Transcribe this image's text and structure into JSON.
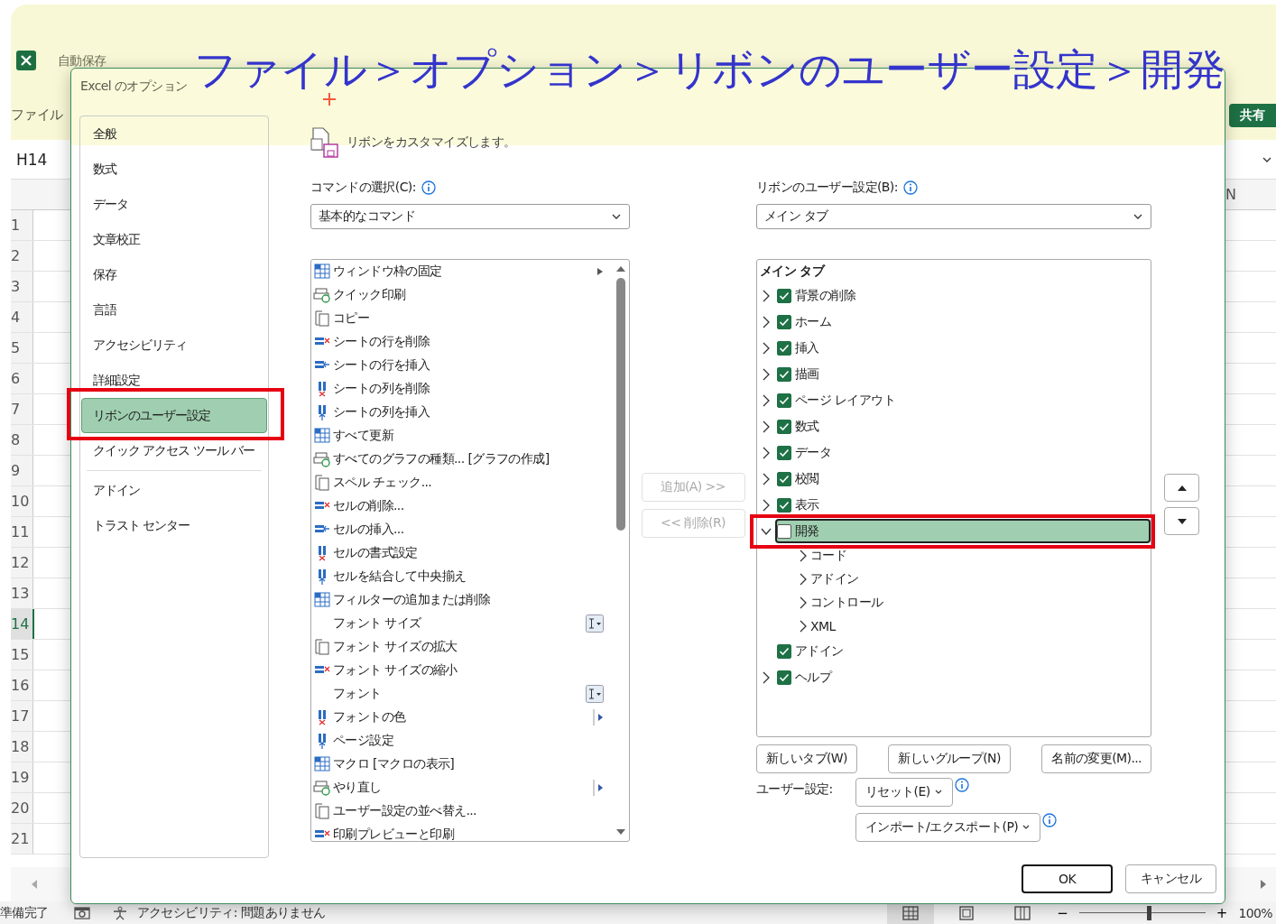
{
  "excel": {
    "autosave": "自動保存",
    "ribbon_tab": "ファイル",
    "share_button": "共有",
    "name_box": "H14",
    "column_header": "N",
    "row_numbers": [
      {
        "label": "1",
        "selected": false
      },
      {
        "label": "2",
        "selected": false
      },
      {
        "label": "3",
        "selected": false
      },
      {
        "label": "4",
        "selected": false
      },
      {
        "label": "5",
        "selected": false
      },
      {
        "label": "6",
        "selected": false
      },
      {
        "label": "7",
        "selected": false
      },
      {
        "label": "8",
        "selected": false
      },
      {
        "label": "9",
        "selected": false
      },
      {
        "label": "10",
        "selected": false
      },
      {
        "label": "11",
        "selected": false
      },
      {
        "label": "12",
        "selected": false
      },
      {
        "label": "13",
        "selected": false
      },
      {
        "label": "14",
        "selected": true
      },
      {
        "label": "15",
        "selected": false
      },
      {
        "label": "16",
        "selected": false
      },
      {
        "label": "17",
        "selected": false
      },
      {
        "label": "18",
        "selected": false
      },
      {
        "label": "19",
        "selected": false
      },
      {
        "label": "20",
        "selected": false
      },
      {
        "label": "21",
        "selected": false
      }
    ],
    "status_text": "準備完了",
    "accessibility": "アクセシビリティ: 問題ありません",
    "views": [
      {
        "kind": "normal",
        "selected": true
      },
      {
        "kind": "page-layout",
        "selected": false
      },
      {
        "kind": "page-break",
        "selected": false
      }
    ],
    "zoom": {
      "minus": "−",
      "plus": "+",
      "level": 0.55,
      "reading": "100%"
    }
  },
  "dialog": {
    "title": "Excel のオプション",
    "sidebar": {
      "groups": [
        {
          "items": [
            {
              "label": "全般",
              "selected": false,
              "highlighted": false
            },
            {
              "label": "数式",
              "selected": false,
              "highlighted": false
            },
            {
              "label": "データ",
              "selected": false,
              "highlighted": false
            },
            {
              "label": "文章校正",
              "selected": false,
              "highlighted": false
            },
            {
              "label": "保存",
              "selected": false,
              "highlighted": false
            },
            {
              "label": "言語",
              "selected": false,
              "highlighted": false
            },
            {
              "label": "アクセシビリティ",
              "selected": false,
              "highlighted": false
            },
            {
              "label": "詳細設定",
              "selected": false,
              "highlighted": false
            },
            {
              "label": "リボンのユーザー設定",
              "selected": true,
              "highlighted": true
            },
            {
              "label": "クイック アクセス ツール バー",
              "selected": false,
              "highlighted": false
            }
          ]
        },
        {
          "items": [
            {
              "label": "アドイン",
              "selected": false,
              "highlighted": false
            },
            {
              "label": "トラスト センター",
              "selected": false,
              "highlighted": false
            }
          ]
        }
      ]
    },
    "header": "リボンをカスタマイズします。",
    "commands": {
      "label": "コマンドの選択(C):",
      "dropdown": "基本的なコマンド",
      "items": [
        {
          "label": "ウィンドウ枠の固定",
          "kind": "submenu"
        },
        {
          "label": "クイック印刷",
          "kind": "command"
        },
        {
          "label": "コピー",
          "kind": "command"
        },
        {
          "label": "シートの行を削除",
          "kind": "command"
        },
        {
          "label": "シートの行を挿入",
          "kind": "command"
        },
        {
          "label": "シートの列を削除",
          "kind": "command"
        },
        {
          "label": "シートの列を挿入",
          "kind": "command"
        },
        {
          "label": "すべて更新",
          "kind": "command"
        },
        {
          "label": "すべてのグラフの種類... [グラフの作成]",
          "kind": "command"
        },
        {
          "label": "スペル チェック...",
          "kind": "command"
        },
        {
          "label": "セルの削除...",
          "kind": "command"
        },
        {
          "label": "セルの挿入...",
          "kind": "command"
        },
        {
          "label": "セルの書式設定",
          "kind": "command"
        },
        {
          "label": "セルを結合して中央揃え",
          "kind": "command"
        },
        {
          "label": "フィルターの追加または削除",
          "kind": "command"
        },
        {
          "label": "フォント サイズ",
          "kind": "combo"
        },
        {
          "label": "フォント サイズの拡大",
          "kind": "command"
        },
        {
          "label": "フォント サイズの縮小",
          "kind": "command"
        },
        {
          "label": "フォント",
          "kind": "combo"
        },
        {
          "label": "フォントの色",
          "kind": "split"
        },
        {
          "label": "ページ設定",
          "kind": "command"
        },
        {
          "label": "マクロ [マクロの表示]",
          "kind": "command"
        },
        {
          "label": "やり直し",
          "kind": "split"
        },
        {
          "label": "ユーザー設定の並べ替え...",
          "kind": "command"
        },
        {
          "label": "印刷プレビューと印刷",
          "kind": "command"
        }
      ]
    },
    "add_button": {
      "label": "追加(A) >>",
      "disabled": true
    },
    "remove_button": {
      "label": "<< 削除(R)",
      "disabled": true
    },
    "ribbon": {
      "label": "リボンのユーザー設定(B):",
      "dropdown": "メイン タブ",
      "tree_header": "メイン タブ",
      "tabs": [
        {
          "label": "背景の削除",
          "checked": true,
          "expandable": true,
          "expanded": false,
          "selected": false,
          "highlighted": false
        },
        {
          "label": "ホーム",
          "checked": true,
          "expandable": true,
          "expanded": false,
          "selected": false,
          "highlighted": false
        },
        {
          "label": "挿入",
          "checked": true,
          "expandable": true,
          "expanded": false,
          "selected": false,
          "highlighted": false
        },
        {
          "label": "描画",
          "checked": true,
          "expandable": true,
          "expanded": false,
          "selected": false,
          "highlighted": false
        },
        {
          "label": "ページ レイアウト",
          "checked": true,
          "expandable": true,
          "expanded": false,
          "selected": false,
          "highlighted": false
        },
        {
          "label": "数式",
          "checked": true,
          "expandable": true,
          "expanded": false,
          "selected": false,
          "highlighted": false
        },
        {
          "label": "データ",
          "checked": true,
          "expandable": true,
          "expanded": false,
          "selected": false,
          "highlighted": false
        },
        {
          "label": "校閲",
          "checked": true,
          "expandable": true,
          "expanded": false,
          "selected": false,
          "highlighted": false
        },
        {
          "label": "表示",
          "checked": true,
          "expandable": true,
          "expanded": false,
          "selected": false,
          "highlighted": false
        },
        {
          "label": "開発",
          "checked": false,
          "expandable": true,
          "expanded": true,
          "selected": true,
          "highlighted": true,
          "children": [
            {
              "label": "コード"
            },
            {
              "label": "アドイン"
            },
            {
              "label": "コントロール"
            },
            {
              "label": "XML"
            }
          ]
        },
        {
          "label": "アドイン",
          "checked": true,
          "expandable": false,
          "expanded": false,
          "selected": false,
          "highlighted": false
        },
        {
          "label": "ヘルプ",
          "checked": true,
          "expandable": true,
          "expanded": false,
          "selected": false,
          "highlighted": false
        }
      ]
    },
    "tree_buttons": [
      "新しいタブ(W)",
      "新しいグループ(N)",
      "名前の変更(M)..."
    ],
    "customizations_label": "ユーザー設定:",
    "reset_button": "リセット(E)",
    "import_export_button": "インポート/エクスポート(P)",
    "ok_button": "OK",
    "cancel_button": "キャンセル"
  },
  "annotation": {
    "caption": "ファイル＞オプション＞リボンのユーザー設定＞開発"
  }
}
